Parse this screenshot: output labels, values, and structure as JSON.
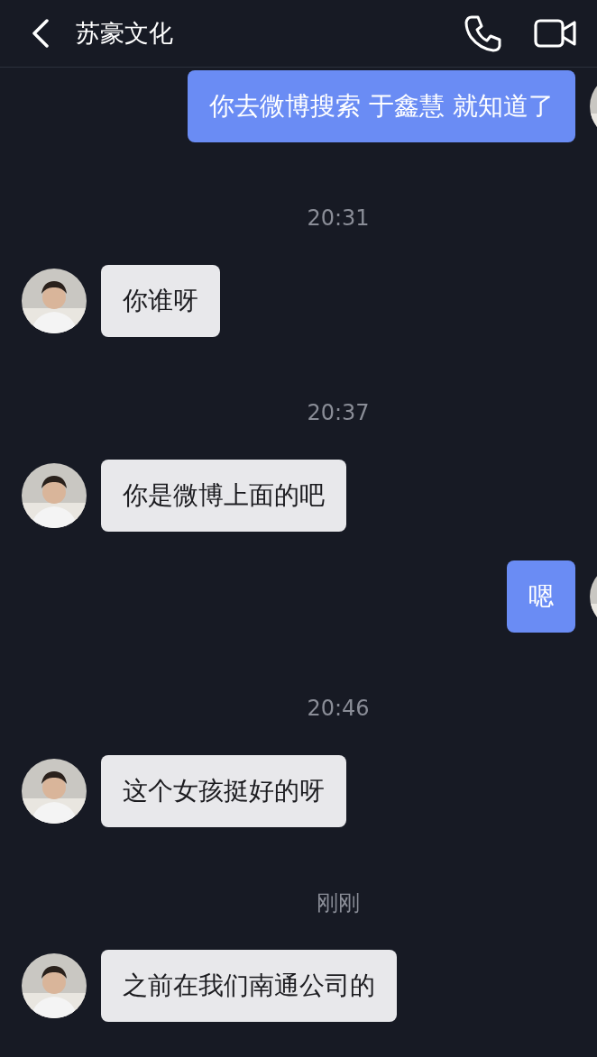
{
  "header": {
    "title": "苏豪文化"
  },
  "messages": [
    {
      "kind": "sent",
      "text": "你去微博搜索 于鑫慧 就知道了"
    },
    {
      "kind": "time",
      "text": "20:31"
    },
    {
      "kind": "received",
      "text": "你谁呀"
    },
    {
      "kind": "time",
      "text": "20:37"
    },
    {
      "kind": "received",
      "text": "你是微博上面的吧"
    },
    {
      "kind": "sent",
      "text": "嗯"
    },
    {
      "kind": "time",
      "text": "20:46"
    },
    {
      "kind": "received",
      "text": "这个女孩挺好的呀"
    },
    {
      "kind": "time",
      "text": "刚刚"
    },
    {
      "kind": "received",
      "text": "之前在我们南通公司的"
    }
  ]
}
